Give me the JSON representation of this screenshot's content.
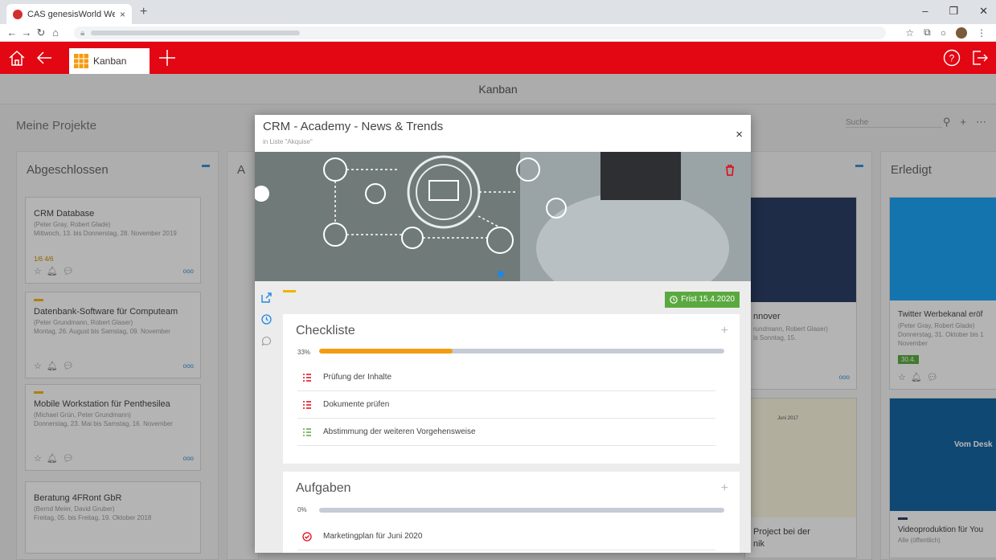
{
  "browser": {
    "tab_title": "CAS genesisWorld Web",
    "tab_close": "×",
    "new_tab": "+"
  },
  "app": {
    "tab_label": "Kanban",
    "page_title": "Kanban"
  },
  "board": {
    "title": "Meine Projekte",
    "search_placeholder": "Suche",
    "columns": [
      {
        "title": "Abgeschlossen",
        "cards": [
          {
            "title": "CRM Database",
            "people": "(Peter Gray, Robert Glade)",
            "dates": "Mittwoch, 13. bis Donnerstag, 28. November 2019",
            "stats": "1/6  4/6"
          },
          {
            "title": "Datenbank-Software für Computeam",
            "people": "(Peter Grundmann, Robert Glaser)",
            "dates": "Montag, 26. August bis Samstag, 09. November"
          },
          {
            "title": "Mobile Workstation für Penthesilea",
            "people": "(Michael Grün, Peter Grundmann)",
            "dates": "Donnerstag, 23. Mai bis Samstag, 16. November"
          },
          {
            "title": "Beratung 4FRont GbR",
            "people": "(Bernd Meier, David Gruber)",
            "dates": "Freitag, 05. bis Freitag, 19. Oktober 2018"
          }
        ]
      },
      {
        "title": "Erledigt",
        "cards": [
          {
            "title": "Twitter Werbekanal eröf",
            "people": "(Peter Gray, Robert Glade)",
            "dates": "Donnerstag, 31. Oktober bis 1 November",
            "badge": "30.4."
          },
          {
            "title": "Videoproduktion für You",
            "people": "Alle (öffentlich)",
            "dates": "",
            "image_text": "Vom Desk"
          }
        ]
      }
    ],
    "partial_card": {
      "title_fragment": "nnover",
      "people": "rundmann, Robert Glaser)",
      "dates": "is Sonntag, 15.",
      "gantt_header": "Juni 2017",
      "bottom_title": "Project bei der",
      "bottom_sub": "nik"
    }
  },
  "modal": {
    "title": "CRM - Academy - News & Trends",
    "subtitle": "in Liste \"Akquise\"",
    "close": "×",
    "deadline": "Frist 15.4.2020",
    "checklist": {
      "title": "Checkliste",
      "percent_label": "33%",
      "progress": 0.33,
      "items": [
        {
          "label": "Prüfung der Inhalte",
          "state": "open"
        },
        {
          "label": "Dokumente prüfen",
          "state": "open"
        },
        {
          "label": "Abstimmung der weiteren Vorgehensweise",
          "state": "done"
        }
      ]
    },
    "tasks": {
      "title": "Aufgaben",
      "percent_label": "0%",
      "progress": 0,
      "items": [
        {
          "label": "Marketingplan für Juni 2020"
        }
      ]
    }
  },
  "colors": {
    "brand_red": "#e30613",
    "deadline_green": "#5aa93f",
    "progress_orange": "#f39c12",
    "accent_blue": "#3a8fd1"
  }
}
